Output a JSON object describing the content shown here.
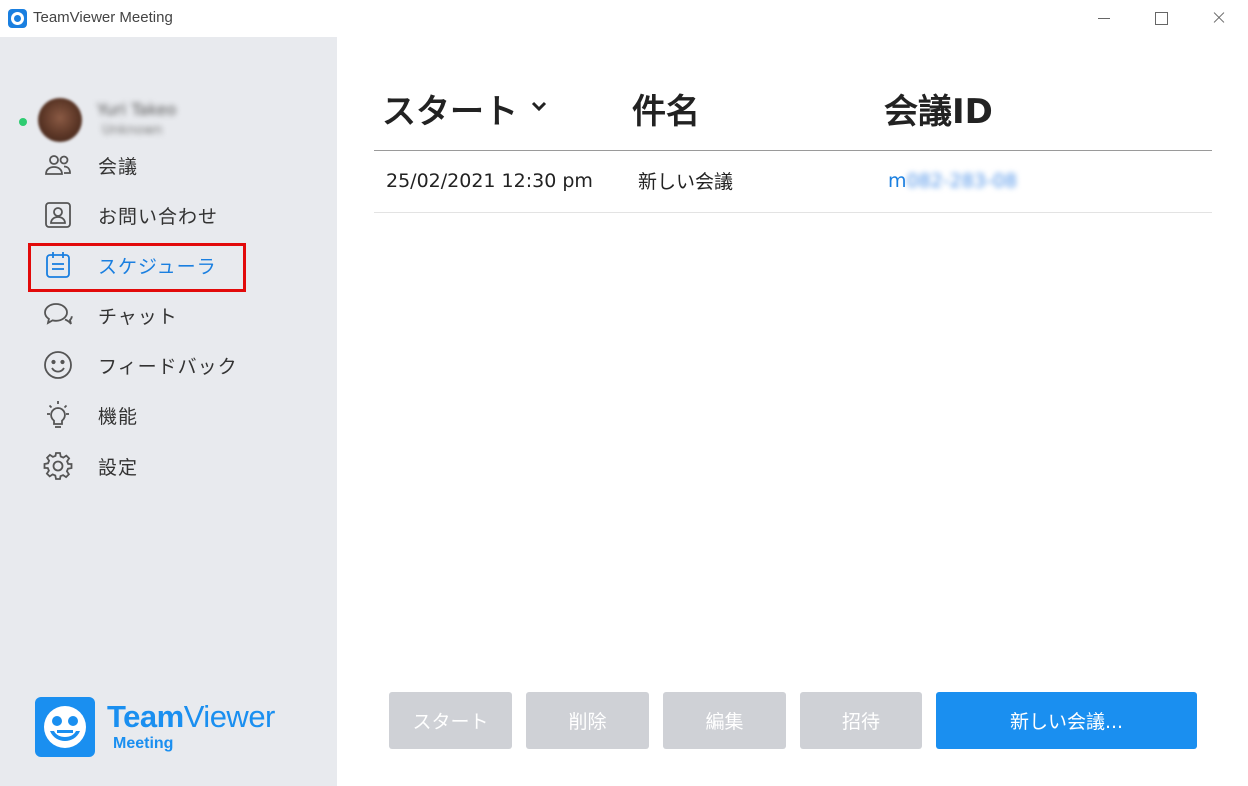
{
  "window": {
    "title": "TeamViewer Meeting"
  },
  "profile": {
    "name": "Yuri Takeo",
    "subtitle": "Unknown",
    "status_color": "#2ecc71"
  },
  "sidebar": {
    "items": [
      {
        "label": "会議",
        "icon": "people-icon"
      },
      {
        "label": "お問い合わせ",
        "icon": "contact-card-icon"
      },
      {
        "label": "スケジューラ",
        "icon": "calendar-icon",
        "active": true
      },
      {
        "label": "チャット",
        "icon": "chat-bubbles-icon"
      },
      {
        "label": "フィードバック",
        "icon": "smiley-icon"
      },
      {
        "label": "機能",
        "icon": "lightbulb-icon"
      },
      {
        "label": "設定",
        "icon": "gear-icon"
      }
    ]
  },
  "logo": {
    "brand_bold": "Team",
    "brand_regular": "Viewer",
    "product": "Meeting",
    "color": "#1a8ff0"
  },
  "table": {
    "headers": [
      "スタート",
      "件名",
      "会議ID"
    ],
    "rows": [
      {
        "date": "25/02/2021 12:30 pm",
        "subject": "新しい会議",
        "meeting_id": "m",
        "meeting_id_blurred": "082-283-08"
      }
    ]
  },
  "buttons": {
    "start": "スタート",
    "delete": "削除",
    "edit": "編集",
    "invite": "招待",
    "new_meeting": "新しい会議..."
  },
  "colors": {
    "accent": "#1a8ff0",
    "sidebar_bg": "#e8eaee",
    "disabled_button": "#cfd1d6",
    "highlight": "#e20a0a"
  }
}
